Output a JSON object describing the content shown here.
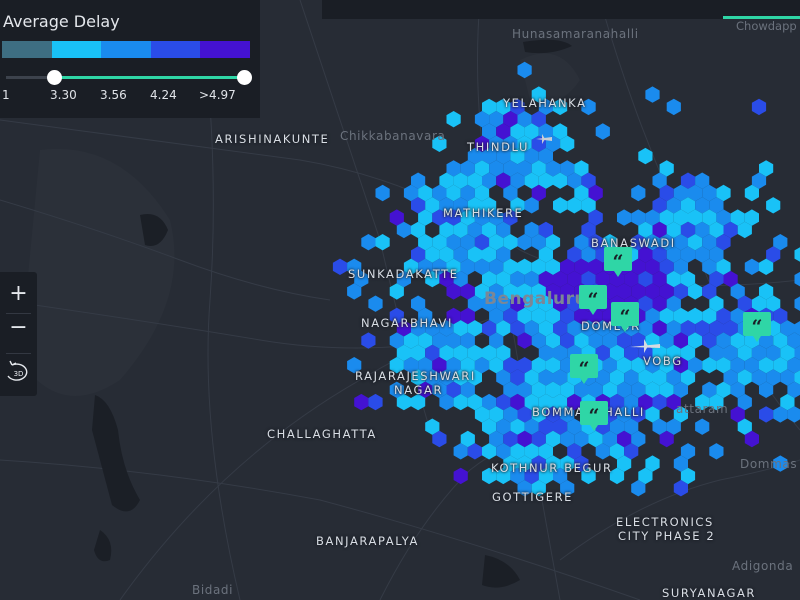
{
  "legend": {
    "title": "Average Delay",
    "colors": [
      "#3e6e82",
      "#19c2f7",
      "#1a8bee",
      "#2a4ce8",
      "#4412d2"
    ],
    "ticks": [
      "1",
      "3.30",
      "3.56",
      "4.24",
      ">4.97"
    ],
    "range": {
      "from_label": "3.30",
      "to_label": ">4.97"
    }
  },
  "zoom": {
    "in_label": "+",
    "out_label": "−",
    "view_label": "3D"
  },
  "top_tab": {
    "label": "Chowdapp"
  },
  "icons": {
    "marker": "quote-chat-icon",
    "airport": "airplane-icon"
  },
  "places": {
    "hunasamaranahalli": "Hunasamaranahalli",
    "yelahanka": "YELAHANKA",
    "arishinakunte": "ARISHINAKUNTE",
    "chikkabanavara": "Chikkabanavara",
    "thindlu": "THINDLU",
    "mathikere": "MATHIKERE",
    "banaswadi": "BANASWADI",
    "sunkadakatte": "SUNKADAKATTE",
    "bengaluru": "Bengaluru",
    "nagarbhavi": "NAGARBHAVI",
    "domlur": "DOMLUR",
    "vobg": "VOBG",
    "rajarajeshwari": "RAJARAJESHWARI",
    "nagar": "NAGAR",
    "bommanahalli": "BOMMANAHALLI",
    "challaghatta": "CHALLAGHATTA",
    "kothnur_begur": "KOTHNUR BEGUR",
    "gottigere": "GOTTIGERE",
    "electronics_city": "ELECTRONICS",
    "electronics_city_2": "CITY PHASE 2",
    "banjarapalya": "BANJARAPALYA",
    "bidadi": "Bidadi",
    "suryanagar": "SURYANAGAR",
    "adigonda": "Adigonda",
    "dommas": "Dommas",
    "attaram": "attaram"
  }
}
